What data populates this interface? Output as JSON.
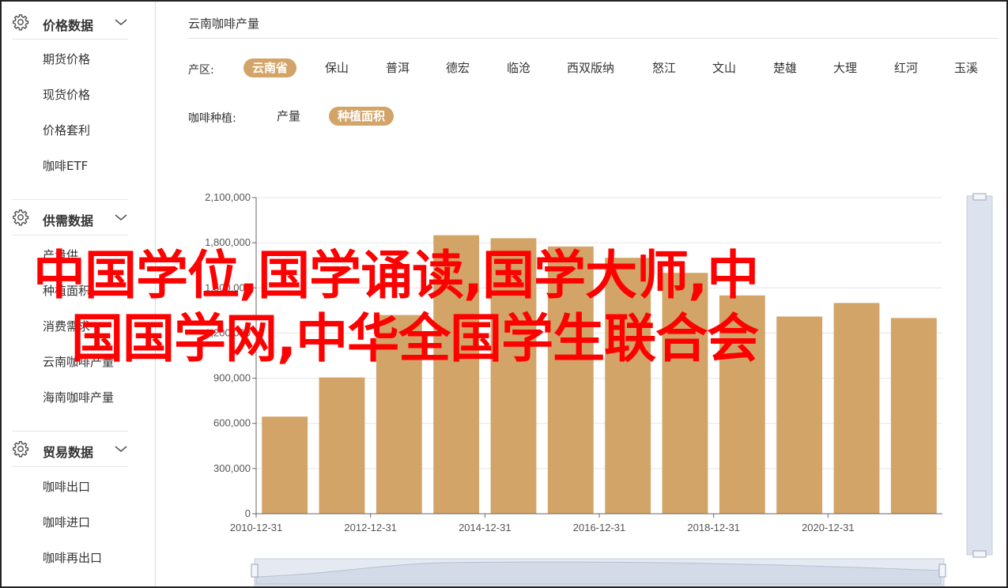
{
  "sidebar": {
    "groups": [
      {
        "title": "价格数据",
        "icon": "gear-icon",
        "items": [
          "期货价格",
          "现货价格",
          "价格套利",
          "咖啡ETF"
        ]
      },
      {
        "title": "供需数据",
        "icon": "gear-icon",
        "items": [
          "产量供",
          "种植面积",
          "消费需求",
          "云南咖啡产量",
          "海南咖啡产量"
        ]
      },
      {
        "title": "贸易数据",
        "icon": "gear-icon",
        "items": [
          "咖啡出口",
          "咖啡进口",
          "咖啡再出口"
        ]
      }
    ]
  },
  "main": {
    "breadcrumb": "云南咖啡产量",
    "region_filter": {
      "label": "产区:",
      "options": [
        "云南省",
        "保山",
        "普洱",
        "德宏",
        "临沧",
        "西双版纳",
        "怒江",
        "文山",
        "楚雄",
        "大理",
        "红河",
        "玉溪"
      ],
      "selected": "云南省"
    },
    "type_filter": {
      "label": "咖啡种植:",
      "options": [
        "产量",
        "种植面积"
      ],
      "selected": "种植面积"
    }
  },
  "overlay": {
    "line1": "中国学位,国学诵读,国学大师,中",
    "line2": "国国学网,中华全国学生联合会"
  },
  "colors": {
    "accent": "#d2a468",
    "bar": "#d2a468",
    "overlay": "#ff0000",
    "grid": "#e6e6e6"
  },
  "chart_data": {
    "type": "bar",
    "categories": [
      "2010-12-31",
      "2011-12-31",
      "2012-12-31",
      "2013-12-31",
      "2014-12-31",
      "2015-12-31",
      "2016-12-31",
      "2017-12-31",
      "2018-12-31",
      "2019-12-31",
      "2020-12-31",
      "2021-12-31"
    ],
    "values": [
      645000,
      905000,
      1320000,
      1850000,
      1830000,
      1775000,
      1700000,
      1600000,
      1450000,
      1310000,
      1400000,
      1300000
    ],
    "x_tick_labels": [
      "2010-12-31",
      "2012-12-31",
      "2014-12-31",
      "2016-12-31",
      "2018-12-31",
      "2020-12-31"
    ],
    "y_ticks": [
      "0",
      "300,000",
      "600,000",
      "900,000",
      "1,200,000",
      "1,500,000",
      "1,800,000",
      "2,100,000"
    ],
    "ylim": [
      0,
      2100000
    ],
    "grid": true,
    "title": "",
    "xlabel": "",
    "ylabel": ""
  }
}
